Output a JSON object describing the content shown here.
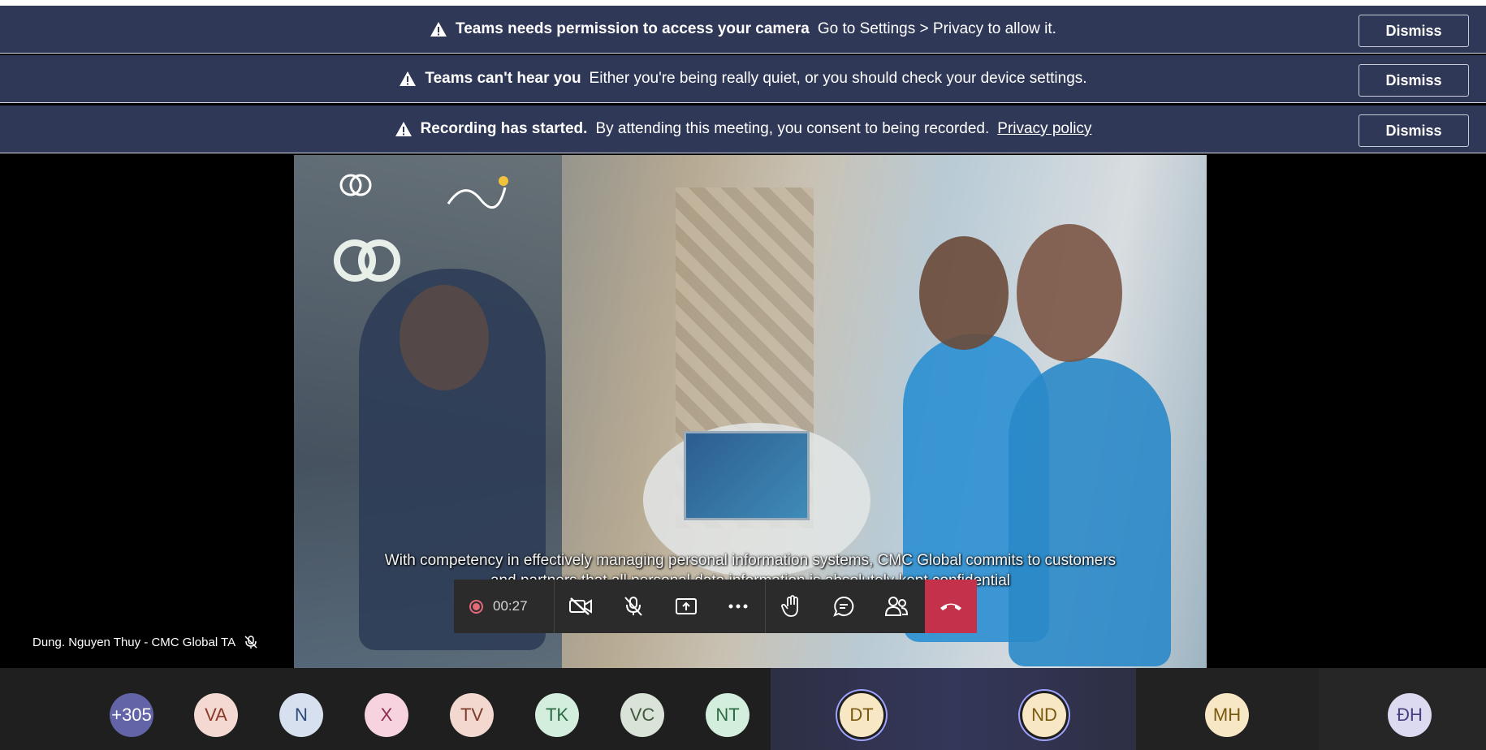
{
  "banners": [
    {
      "bold": "Teams needs permission to access your camera",
      "text": "Go to Settings > Privacy to allow it.",
      "link": "",
      "dismiss": "Dismiss"
    },
    {
      "bold": "Teams can't hear you",
      "text": "Either you're being really quiet, or you should check your device settings.",
      "link": "",
      "dismiss": "Dismiss"
    },
    {
      "bold": "Recording has started.",
      "text": "By attending this meeting, you consent to being recorded.",
      "link": "Privacy policy",
      "dismiss": "Dismiss"
    }
  ],
  "presenter": {
    "name": "Dung. Nguyen Thuy - CMC Global TA"
  },
  "video": {
    "caption_line1": "With competency in effectively managing personal information systems, CMC Global commits to customers",
    "caption_line2": "and partners that all personal data information is absolutely kept confidential"
  },
  "controls": {
    "recording_time": "00:27",
    "icons": [
      "camera-off-icon",
      "mic-off-icon",
      "share-screen-icon",
      "more-options-icon",
      "raise-hand-icon",
      "chat-icon",
      "participants-icon",
      "hang-up-icon"
    ]
  },
  "participants": [
    {
      "initials": "+305",
      "bg": "#6264a7",
      "fg": "#ffffff"
    },
    {
      "initials": "VA",
      "bg": "#f4d9d2",
      "fg": "#8a3a2a"
    },
    {
      "initials": "N",
      "bg": "#d7e0ef",
      "fg": "#2e4a7a"
    },
    {
      "initials": "X",
      "bg": "#f6d3df",
      "fg": "#8c2c50"
    },
    {
      "initials": "TV",
      "bg": "#f3d8cf",
      "fg": "#7d3c2a"
    },
    {
      "initials": "TK",
      "bg": "#d3eedd",
      "fg": "#2b6b45"
    },
    {
      "initials": "VC",
      "bg": "#d9e3d8",
      "fg": "#3f5a3d"
    },
    {
      "initials": "NT",
      "bg": "#d3eedd",
      "fg": "#2b6b45"
    },
    {
      "initials": "DT",
      "bg": "#f8e7c4",
      "fg": "#7a5a12"
    },
    {
      "initials": "ND",
      "bg": "#f8e7c4",
      "fg": "#7a5a12"
    },
    {
      "initials": "MH",
      "bg": "#f8e7c4",
      "fg": "#7a5a12"
    },
    {
      "initials": "ĐH",
      "bg": "#dcdaf0",
      "fg": "#45407e"
    }
  ],
  "colors": {
    "banner": "#2f3857",
    "hangup": "#c4314b",
    "recording": "#e36a78",
    "speaking_ring": "#9ea2ff"
  }
}
